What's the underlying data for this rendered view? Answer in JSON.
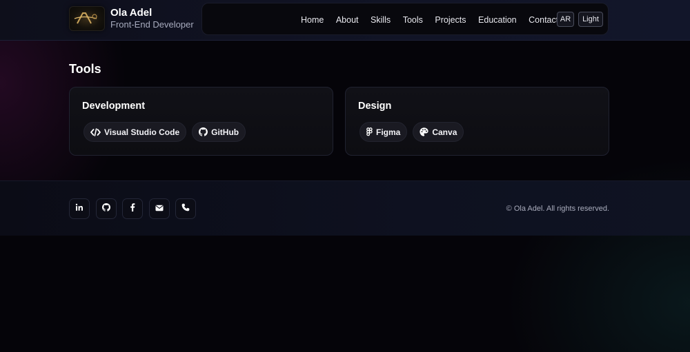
{
  "header": {
    "name": "Ola Adel",
    "role": "Front-End Developer",
    "logo_text": "OA",
    "nav": [
      "Home",
      "About",
      "Skills",
      "Tools",
      "Projects",
      "Education",
      "Contact"
    ],
    "lang_button": "AR",
    "theme_button": "Light"
  },
  "tools": {
    "title": "Tools",
    "cards": [
      {
        "title": "Development",
        "chips": [
          {
            "label": "Visual Studio Code",
            "icon": "code-icon"
          },
          {
            "label": "GitHub",
            "icon": "github-icon"
          }
        ]
      },
      {
        "title": "Design",
        "chips": [
          {
            "label": "Figma",
            "icon": "figma-icon"
          },
          {
            "label": "Canva",
            "icon": "palette-icon"
          }
        ]
      }
    ]
  },
  "footer": {
    "socials": [
      "linkedin-icon",
      "github-icon",
      "facebook-icon",
      "envelope-icon",
      "phone-icon"
    ],
    "copyright": "© Ola Adel. All rights reserved."
  },
  "colors": {
    "background": "#050409",
    "card": "#111117",
    "chip": "#1a1a22",
    "text": "#ffffff",
    "muted": "#a8acbf"
  }
}
